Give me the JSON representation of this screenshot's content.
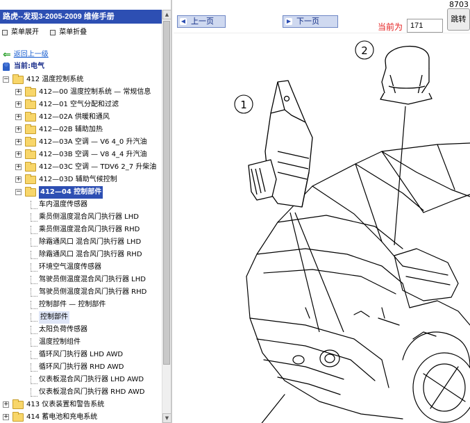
{
  "left": {
    "title": "路虎--发现3-2005-2009 维修手册",
    "menu": {
      "expand_label": "菜单展开",
      "collapse_label": "菜单折叠"
    },
    "back_label": "返回上一级",
    "current_label": "当前:电气",
    "tree": [
      {
        "level": 0,
        "type": "folder",
        "expanded": true,
        "label": "412 温度控制系统"
      },
      {
        "level": 1,
        "type": "folder",
        "expanded": false,
        "label": "412—00 温度控制系统 — 常规信息"
      },
      {
        "level": 1,
        "type": "folder",
        "expanded": false,
        "label": "412—01 空气分配和过滤"
      },
      {
        "level": 1,
        "type": "folder",
        "expanded": false,
        "label": "412—02A 供暖和通风"
      },
      {
        "level": 1,
        "type": "folder",
        "expanded": false,
        "label": "412—02B 辅助加热"
      },
      {
        "level": 1,
        "type": "folder",
        "expanded": false,
        "label": "412—03A 空调 — V6 4_0 升汽油"
      },
      {
        "level": 1,
        "type": "folder",
        "expanded": false,
        "label": "412—03B 空调 — V8 4_4 升汽油"
      },
      {
        "level": 1,
        "type": "folder",
        "expanded": false,
        "label": "412—03C 空调 — TDV6 2_7 升柴油"
      },
      {
        "level": 1,
        "type": "folder",
        "expanded": false,
        "label": "412—03D 辅助气候控制"
      },
      {
        "level": 1,
        "type": "folder",
        "expanded": true,
        "label": "412—04 控制部件",
        "selected": true
      },
      {
        "level": 2,
        "type": "doc",
        "label": "车内温度传感器"
      },
      {
        "level": 2,
        "type": "doc",
        "label": "乘员侧温度混合风门执行器 LHD"
      },
      {
        "level": 2,
        "type": "doc",
        "label": "乘员侧温度混合风门执行器 RHD"
      },
      {
        "level": 2,
        "type": "doc",
        "label": "除霜通风口 混合风门执行器 LHD"
      },
      {
        "level": 2,
        "type": "doc",
        "label": "除霜通风口 混合风门执行器 RHD"
      },
      {
        "level": 2,
        "type": "doc",
        "label": "环境空气温度传感器"
      },
      {
        "level": 2,
        "type": "doc",
        "label": "驾驶员侧温度混合风门执行器 LHD"
      },
      {
        "level": 2,
        "type": "doc",
        "label": "驾驶员侧温度混合风门执行器 RHD"
      },
      {
        "level": 2,
        "type": "doc",
        "label": "控制部件 — 控制部件"
      },
      {
        "level": 2,
        "type": "doc",
        "label": "控制部件",
        "highlight": true
      },
      {
        "level": 2,
        "type": "doc",
        "label": "太阳负荷传感器"
      },
      {
        "level": 2,
        "type": "doc",
        "label": "温度控制组件"
      },
      {
        "level": 2,
        "type": "doc",
        "label": "循环风门执行器 LHD AWD"
      },
      {
        "level": 2,
        "type": "doc",
        "label": "循环风门执行器 RHD AWD"
      },
      {
        "level": 2,
        "type": "doc",
        "label": "仪表板混合风门执行器 LHD AWD"
      },
      {
        "level": 2,
        "type": "doc",
        "label": "仪表板混合风门执行器 RHD AWD"
      },
      {
        "level": 0,
        "type": "folder",
        "expanded": false,
        "label": "413 仪表装置和警告系统"
      },
      {
        "level": 0,
        "type": "folder",
        "expanded": false,
        "label": "414 蓄电池和充电系统"
      }
    ]
  },
  "right": {
    "page_number_top": "8703",
    "prev_label": "上一页",
    "next_label": "下一页",
    "current_page_label": "当前为",
    "current_page_value": "171",
    "jump_label": "跳转",
    "callouts": [
      "1",
      "2"
    ]
  }
}
